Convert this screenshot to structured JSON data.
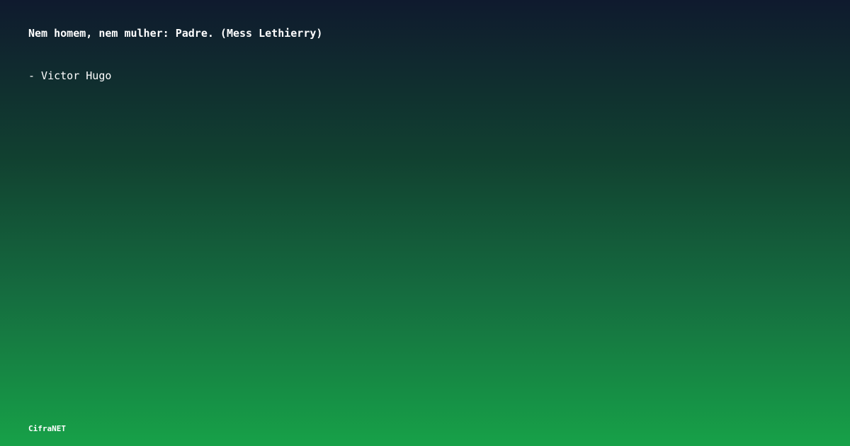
{
  "quote": {
    "text": "Nem homem, nem mulher: Padre. (Mess Lethierry)",
    "author": "- Victor Hugo"
  },
  "brand": {
    "name": "CifraNET"
  },
  "colors": {
    "gradient_top": "#0f1a2e",
    "gradient_bottom": "#17a148",
    "text": "#ffffff"
  }
}
